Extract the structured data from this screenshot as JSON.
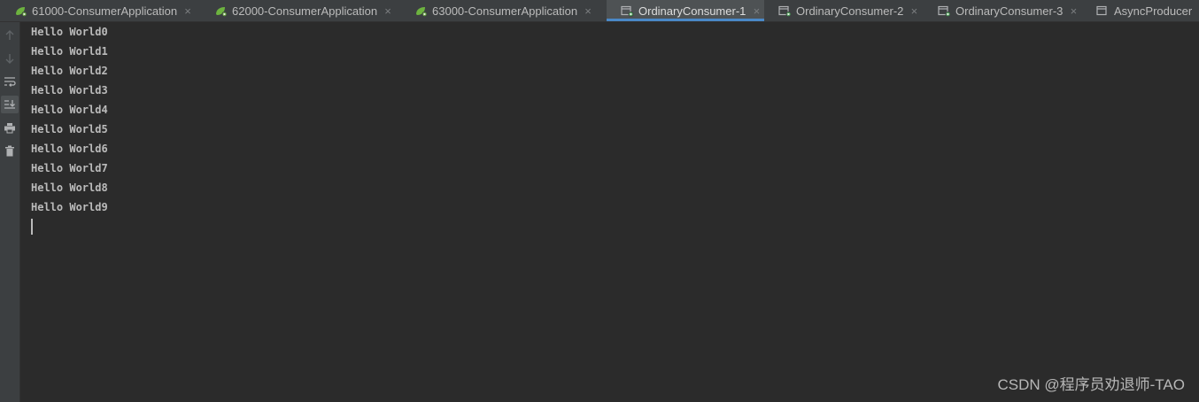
{
  "tabs": [
    {
      "label": "61000-ConsumerApplication",
      "icon": "spring-boot-icon",
      "active": false
    },
    {
      "label": "62000-ConsumerApplication",
      "icon": "spring-boot-icon",
      "active": false
    },
    {
      "label": "63000-ConsumerApplication",
      "icon": "spring-boot-icon",
      "active": false
    },
    {
      "label": "OrdinaryConsumer-1",
      "icon": "run-config-icon",
      "active": true
    },
    {
      "label": "OrdinaryConsumer-2",
      "icon": "run-config-icon",
      "active": false
    },
    {
      "label": "OrdinaryConsumer-3",
      "icon": "run-config-icon",
      "active": false
    },
    {
      "label": "AsyncProducer",
      "icon": "run-config-icon",
      "active": false
    }
  ],
  "close_glyph": "×",
  "toolbar": {
    "buttons": [
      {
        "name": "up-arrow-icon",
        "enabled": false
      },
      {
        "name": "down-arrow-icon",
        "enabled": false
      },
      {
        "name": "soft-wrap-icon",
        "enabled": true
      },
      {
        "name": "scroll-to-end-icon",
        "enabled": true,
        "selected": true
      },
      {
        "name": "print-icon",
        "enabled": true
      },
      {
        "name": "trash-icon",
        "enabled": true
      }
    ]
  },
  "console": {
    "lines": [
      "Hello World0",
      "Hello World1",
      "Hello World2",
      "Hello World3",
      "Hello World4",
      "Hello World5",
      "Hello World6",
      "Hello World7",
      "Hello World8",
      "Hello World9"
    ]
  },
  "watermark": "CSDN @程序员劝退师-TAO",
  "colors": {
    "background": "#2b2b2b",
    "panel": "#3c3f41",
    "text": "#bbbbbb",
    "accent": "#4a88c7",
    "spring_green": "#6db33f"
  }
}
